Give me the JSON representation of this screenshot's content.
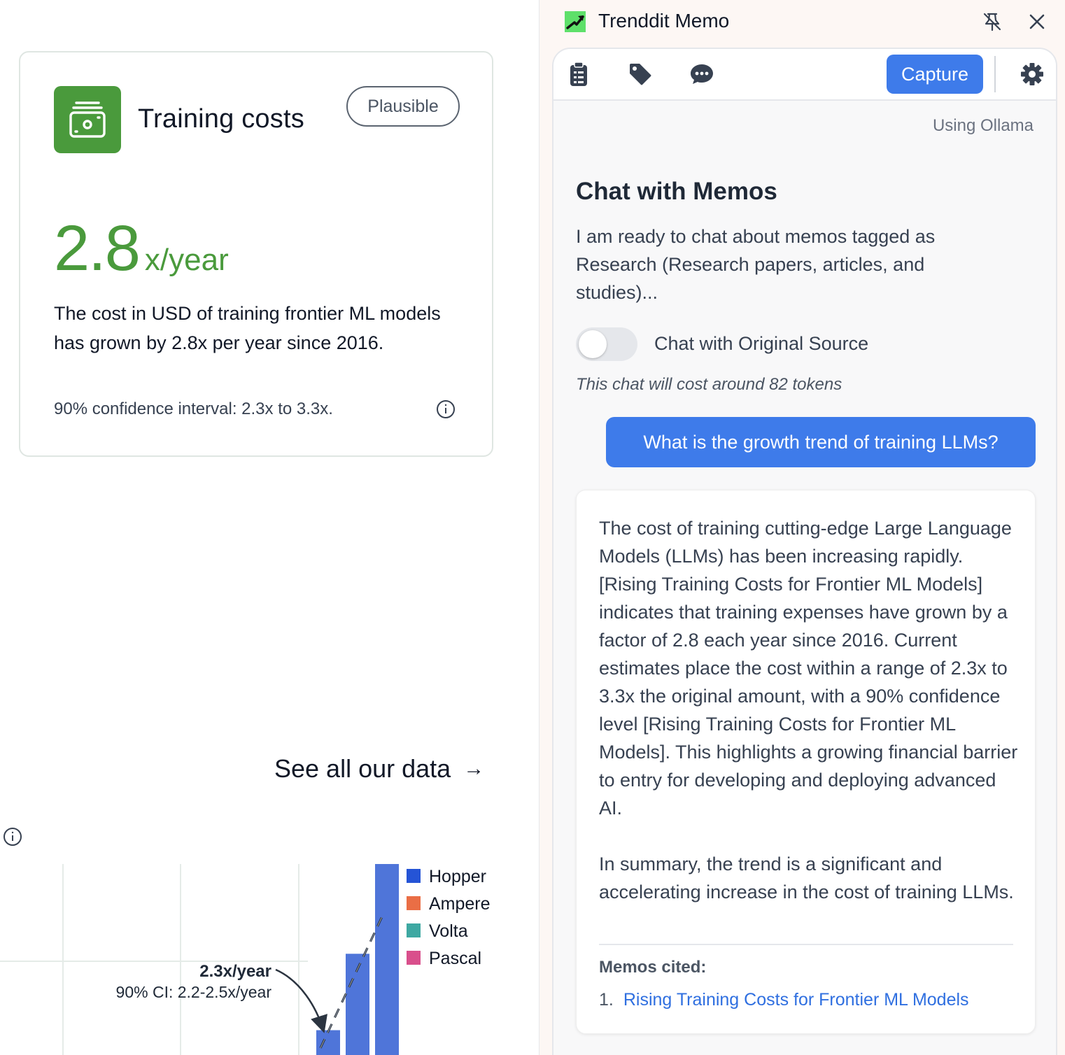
{
  "card": {
    "title": "Training costs",
    "badge": "Plausible",
    "metric_value": "2.8",
    "metric_unit": "x/year",
    "description": "The cost in USD of training frontier ML models has grown by 2.8x per year since 2016.",
    "confidence": "90% confidence interval: 2.3x to 3.3x.",
    "icon": "wallet-icon",
    "accent_color": "#4a9a3c"
  },
  "see_all": {
    "label": "See all our data",
    "arrow": "→"
  },
  "chart_data": {
    "type": "bar",
    "annotation_rate": "2.3x/year",
    "annotation_ci": "90% CI: 2.2-2.5x/year",
    "legend": [
      {
        "name": "Hopper",
        "color": "#2554d6"
      },
      {
        "name": "Ampere",
        "color": "#ea6e45"
      },
      {
        "name": "Volta",
        "color": "#3ea8a2"
      },
      {
        "name": "Pascal",
        "color": "#d94f8c"
      }
    ],
    "bars": [
      {
        "value": 0.13,
        "color": "#4f75d9"
      },
      {
        "value": 0.53,
        "color": "#4f75d9"
      },
      {
        "value": 1.0,
        "color": "#4f75d9"
      }
    ]
  },
  "panel": {
    "app_title": "Trenddit Memo",
    "pin_icon": "unpin-icon",
    "close_icon": "close-icon",
    "toolbar": {
      "capture_label": "Capture",
      "icons": [
        "clipboard-icon",
        "tag-icon",
        "chat-icon",
        "gear-icon"
      ]
    },
    "using_label": "Using Ollama",
    "chat_heading": "Chat with Memos",
    "intro": "I am ready to chat about memos tagged as Research (Research papers, articles, and studies)...",
    "toggle_label": "Chat with Original Source",
    "toggle_on": false,
    "cost_note": "This chat will cost around 82 tokens",
    "user_message": "What is the growth trend of training LLMs?",
    "answer_p1": "The cost of training cutting-edge Large Language Models (LLMs) has been increasing rapidly. [Rising Training Costs for Frontier ML Models] indicates that training expenses have grown by a factor of 2.8 each year since 2016. Current estimates place the cost within a range of 2.3x to 3.3x the original amount, with a 90% confidence level [Rising Training Costs for Frontier ML Models]. This highlights a growing financial barrier to entry for developing and deploying advanced AI.",
    "answer_p2": "In summary, the trend is a significant and accelerating increase in the cost of training LLMs.",
    "cited_heading": "Memos cited:",
    "cited": [
      {
        "num": "1.",
        "title": "Rising Training Costs for Frontier ML Models"
      }
    ],
    "accent_color": "#3e7bea"
  }
}
